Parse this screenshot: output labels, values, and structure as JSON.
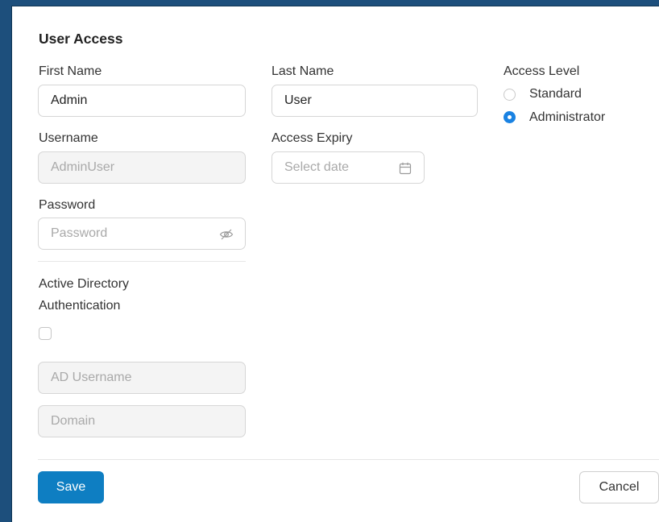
{
  "form": {
    "title": "User Access",
    "first_name": {
      "label": "First Name",
      "value": "Admin"
    },
    "last_name": {
      "label": "Last Name",
      "value": "User"
    },
    "access_level": {
      "label": "Access Level",
      "options": [
        {
          "label": "Standard",
          "selected": false
        },
        {
          "label": "Administrator",
          "selected": true
        }
      ]
    },
    "username": {
      "label": "Username",
      "value": "AdminUser"
    },
    "access_expiry": {
      "label": "Access Expiry",
      "placeholder": "Select date",
      "icon": "calendar-icon"
    },
    "password": {
      "label": "Password",
      "placeholder": "Password",
      "icon": "eye-off-icon"
    },
    "ad_auth": {
      "label_line1": "Active Directory",
      "label_line2": "Authentication",
      "checked": false
    },
    "ad_username": {
      "placeholder": "AD Username"
    },
    "domain": {
      "placeholder": "Domain"
    }
  },
  "footer": {
    "save_label": "Save",
    "cancel_label": "Cancel"
  },
  "colors": {
    "background": "#1d4f7c",
    "primary": "#0e7ec2",
    "radio_selected": "#1a82e2"
  }
}
